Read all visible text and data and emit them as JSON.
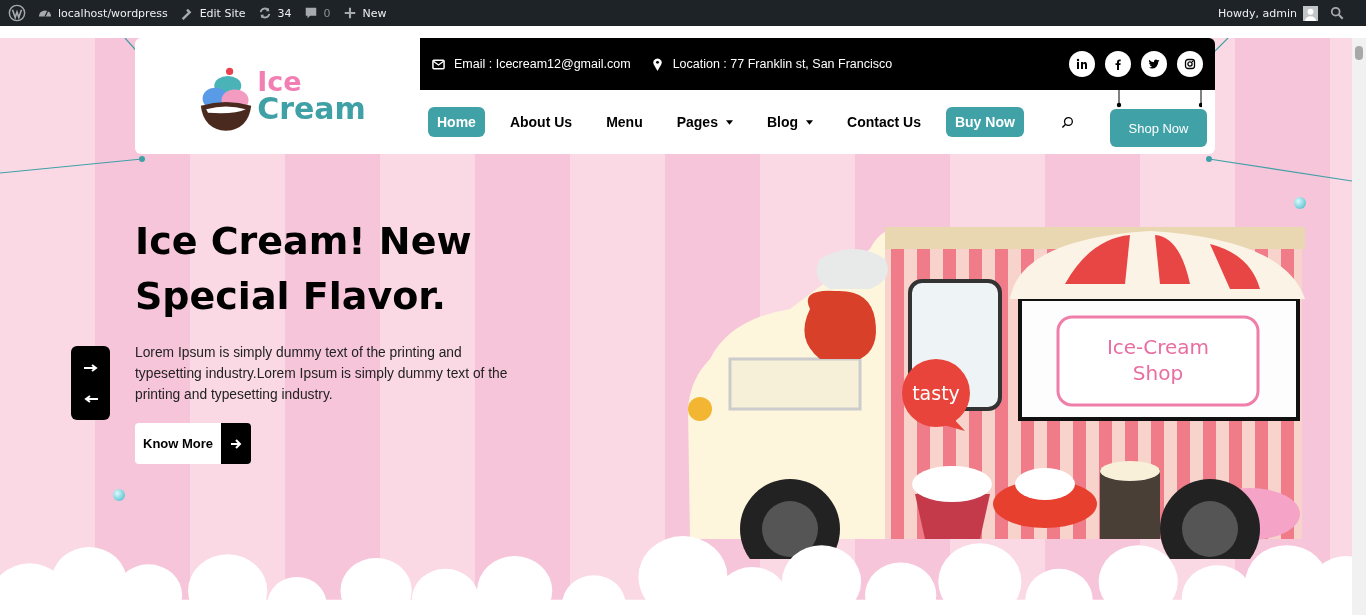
{
  "admin_bar": {
    "left": [
      {
        "kind": "wp-logo"
      },
      {
        "kind": "site",
        "label": "localhost/wordpress"
      },
      {
        "kind": "edit",
        "label": "Edit Site"
      },
      {
        "kind": "updates",
        "label": "34"
      },
      {
        "kind": "comments",
        "label": "0"
      },
      {
        "kind": "new",
        "label": "New"
      }
    ],
    "greeting": "Howdy, admin"
  },
  "header": {
    "logo": {
      "line1": "Ice",
      "line2": "Cream"
    },
    "contact": [
      {
        "kind": "email",
        "text": "Email : Icecream12@gmail.com"
      },
      {
        "kind": "location",
        "text": "Location : 77 Franklin st, San Francisco"
      }
    ],
    "social": [
      {
        "kind": "linkedin"
      },
      {
        "kind": "facebook"
      },
      {
        "kind": "twitter"
      },
      {
        "kind": "instagram"
      }
    ],
    "nav": [
      {
        "label": "Home",
        "selected": true,
        "dropdown": false
      },
      {
        "label": "About Us",
        "selected": false,
        "dropdown": false
      },
      {
        "label": "Menu",
        "selected": false,
        "dropdown": false
      },
      {
        "label": "Pages",
        "selected": false,
        "dropdown": true
      },
      {
        "label": "Blog",
        "selected": false,
        "dropdown": true
      },
      {
        "label": "Contact Us",
        "selected": false,
        "dropdown": false
      }
    ],
    "buy_button": "Buy Now",
    "shop_button": "Shop Now"
  },
  "hero": {
    "title_lines": [
      "Ice Cream! New",
      "Special Flavor."
    ],
    "text": "Lorem Ipsum is simply dummy text of the printing and typesetting industry.Lorem Ipsum is simply dummy text of the printing and typesetting industry.",
    "button": "Know More",
    "illustration": {
      "sign": [
        "Ice-Cream",
        "Shop"
      ],
      "bubble": "tasty"
    }
  }
}
